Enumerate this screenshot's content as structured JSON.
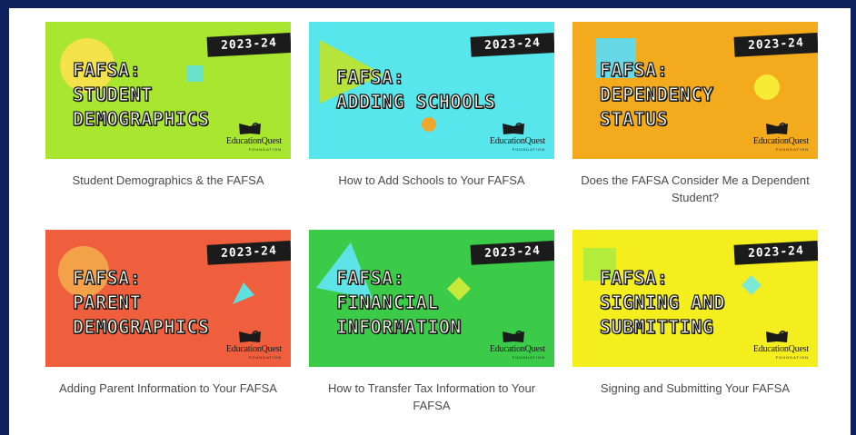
{
  "colors": {
    "frame": "#0d1f5c",
    "panel": "#ffffff",
    "caption_text": "#4a4a4a"
  },
  "brand": {
    "name": "EducationQuest",
    "sub": "FOUNDATION",
    "icon": "open-book-icon"
  },
  "cards": [
    {
      "year": "2023-24",
      "heading": "FAFSA:\nSTUDENT\nDEMOGRAPHICS",
      "caption": "Student Demographics & the FAFSA",
      "bg": "#a8e630",
      "shapes": [
        {
          "kind": "circle",
          "color": "#f4e24a"
        },
        {
          "kind": "square",
          "color": "#69e0c8"
        }
      ]
    },
    {
      "year": "2023-24",
      "heading": "FAFSA:\nADDING SCHOOLS",
      "caption": "How to Add Schools to Your FAFSA",
      "bg": "#56e6ec",
      "shapes": [
        {
          "kind": "triangle",
          "color": "#b6e43a"
        },
        {
          "kind": "circle",
          "color": "#f0a62a"
        }
      ]
    },
    {
      "year": "2023-24",
      "heading": "FAFSA:\nDEPENDENCY\nSTATUS",
      "caption": "Does the FAFSA Consider Me a Dependent Student?",
      "bg": "#f3aa1c",
      "shapes": [
        {
          "kind": "square",
          "color": "#66d8e6"
        },
        {
          "kind": "circle",
          "color": "#f6ea34"
        }
      ]
    },
    {
      "year": "2023-24",
      "heading": "FAFSA:\nPARENT\nDEMOGRAPHICS",
      "caption": "Adding Parent Information to Your FAFSA",
      "bg": "#ef5f3e",
      "shapes": [
        {
          "kind": "circle",
          "color": "#f4a24a"
        },
        {
          "kind": "triangle",
          "color": "#5fe0e0"
        }
      ]
    },
    {
      "year": "2023-24",
      "heading": "FAFSA:\nFINANCIAL\nINFORMATION",
      "caption": "How to Transfer Tax Information to Your FAFSA",
      "bg": "#3bcb48",
      "shapes": [
        {
          "kind": "triangle",
          "color": "#5ee4e6"
        },
        {
          "kind": "diamond",
          "color": "#c6ea3a"
        }
      ]
    },
    {
      "year": "2023-24",
      "heading": "FAFSA:\nSIGNING AND\nSUBMITTING",
      "caption": "Signing and Submitting Your FAFSA",
      "bg": "#f4ee1e",
      "shapes": [
        {
          "kind": "square",
          "color": "#b4ec3c"
        },
        {
          "kind": "diamond",
          "color": "#7ee8d6"
        }
      ]
    }
  ]
}
